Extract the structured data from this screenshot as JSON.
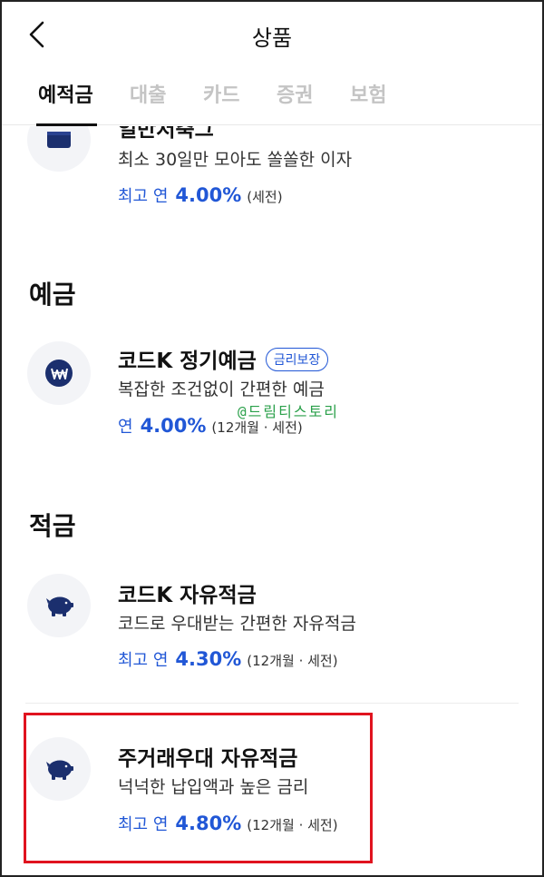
{
  "header": {
    "title": "상품"
  },
  "tabs": [
    {
      "label": "예적금",
      "active": true
    },
    {
      "label": "대출",
      "active": false
    },
    {
      "label": "카드",
      "active": false
    },
    {
      "label": "증권",
      "active": false
    },
    {
      "label": "보험",
      "active": false
    }
  ],
  "products_top": {
    "title_partial": "일반저축그",
    "desc": "최소 30일만 모아도 쏠쏠한 이자",
    "rate_prefix": "최고 연",
    "rate_value": "4.00%",
    "rate_note": "(세전)"
  },
  "sections": {
    "deposit": {
      "title": "예금",
      "product": {
        "title": "코드K 정기예금",
        "badge": "금리보장",
        "desc": "복잡한 조건없이 간편한 예금",
        "rate_prefix": "연",
        "rate_value": "4.00%",
        "rate_note": "(12개월 · 세전)"
      }
    },
    "savings": {
      "title": "적금",
      "products": [
        {
          "title": "코드K 자유적금",
          "desc": "코드로 우대받는 간편한 자유적금",
          "rate_prefix": "최고 연",
          "rate_value": "4.30%",
          "rate_note": "(12개월 · 세전)"
        },
        {
          "title": "주거래우대 자유적금",
          "desc": "넉넉한 납입액과 높은 금리",
          "rate_prefix": "최고 연",
          "rate_value": "4.80%",
          "rate_note": "(12개월 · 세전)"
        }
      ]
    }
  },
  "watermark": "@드림티스토리",
  "colors": {
    "accent": "#2157d6",
    "icon": "#1b2f6e",
    "highlight": "#e0131f"
  }
}
